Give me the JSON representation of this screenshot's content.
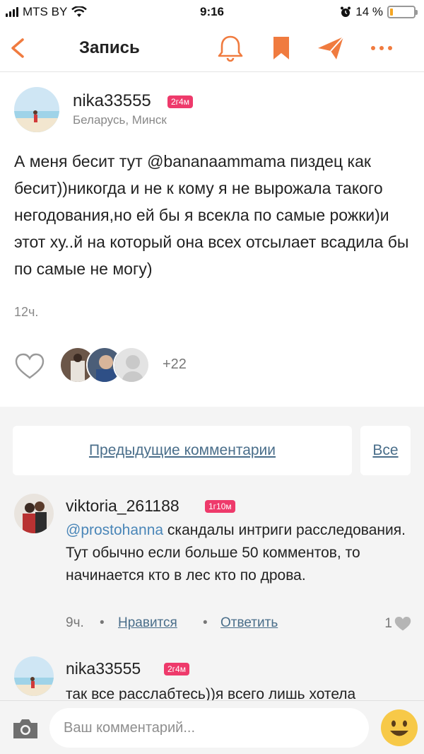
{
  "status_bar": {
    "carrier": "MTS BY",
    "time": "9:16",
    "battery_percent": "14 %",
    "battery_level": 0.14
  },
  "nav": {
    "title": "Запись",
    "icons": [
      "back-icon",
      "bell-icon",
      "bookmark-icon",
      "send-icon",
      "more-icon"
    ],
    "accent_color": "#f07b3f"
  },
  "post": {
    "author": "nika33555",
    "badge": "2г4м",
    "location": "Беларусь, Минск",
    "text": "А меня бесит тут @bananaammama  пиздец как бесит))никогда и не к кому я не вырожала такого негодования,но ей бы я всекла по самые рожки)и этот ху..й на который она всех отсылает всадила бы по самые не могу)",
    "time": "12ч.",
    "likes_more": "+22"
  },
  "comments_section": {
    "previous_label": "Предыдущие комментарии",
    "all_label": "Все",
    "comments": [
      {
        "author": "viktoria_261188",
        "badge": "1г10м",
        "mention": "@prostohanna",
        "text": " скандалы интриги расследования. Тут обычно если больше 50 комментов, то начинается кто в лес кто по дрова.",
        "time": "9ч.",
        "like_label": "Нравится",
        "reply_label": "Ответить",
        "like_count": "1"
      },
      {
        "author": "nika33555",
        "badge": "2г4м",
        "text": "так все расслабтесь))я всего лишь хотела"
      }
    ]
  },
  "input_bar": {
    "placeholder": "Ваш комментарий..."
  }
}
